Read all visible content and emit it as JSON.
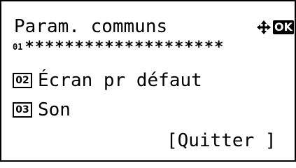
{
  "header": {
    "title": "Param. communs",
    "nav_icon": "four-way-arrow-icon",
    "ok_label": "OK"
  },
  "scrollbar": {
    "position_label": "01",
    "track": "********************"
  },
  "menu": {
    "items": [
      {
        "number": "02",
        "label": "Écran pr défaut"
      },
      {
        "number": "03",
        "label": "Son"
      }
    ]
  },
  "footer": {
    "exit_label": "[Quitter ]"
  },
  "colors": {
    "foreground": "#000000",
    "background": "#ffffff"
  }
}
